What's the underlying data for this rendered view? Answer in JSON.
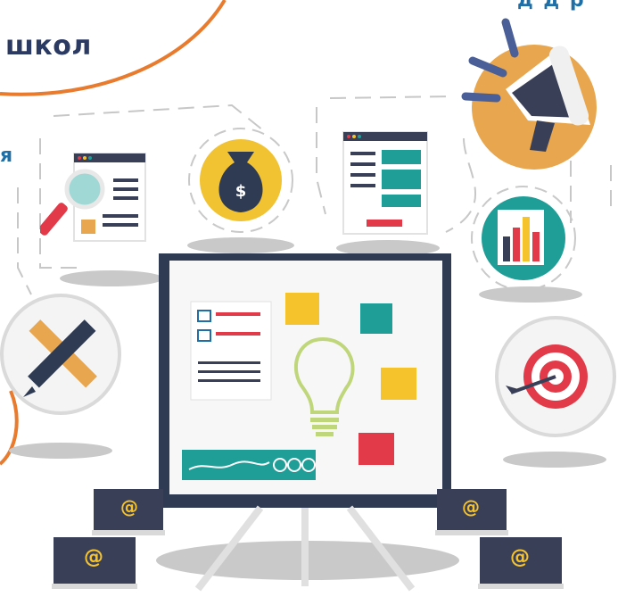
{
  "heading": {
    "text": "школ"
  },
  "fragment_left": {
    "text": "я"
  },
  "fragment_top": {
    "text": "д д р"
  },
  "icons": {
    "money_bag_symbol": "$",
    "laptop_symbol": "@"
  },
  "colors": {
    "orange_accent": "#e87b2e",
    "navy": "#2b3a63",
    "blue_text": "#1f6fa6",
    "teal": "#1f9e98",
    "red": "#e23a48",
    "yellow": "#f5c32b",
    "board_frame": "#2f3b53"
  }
}
